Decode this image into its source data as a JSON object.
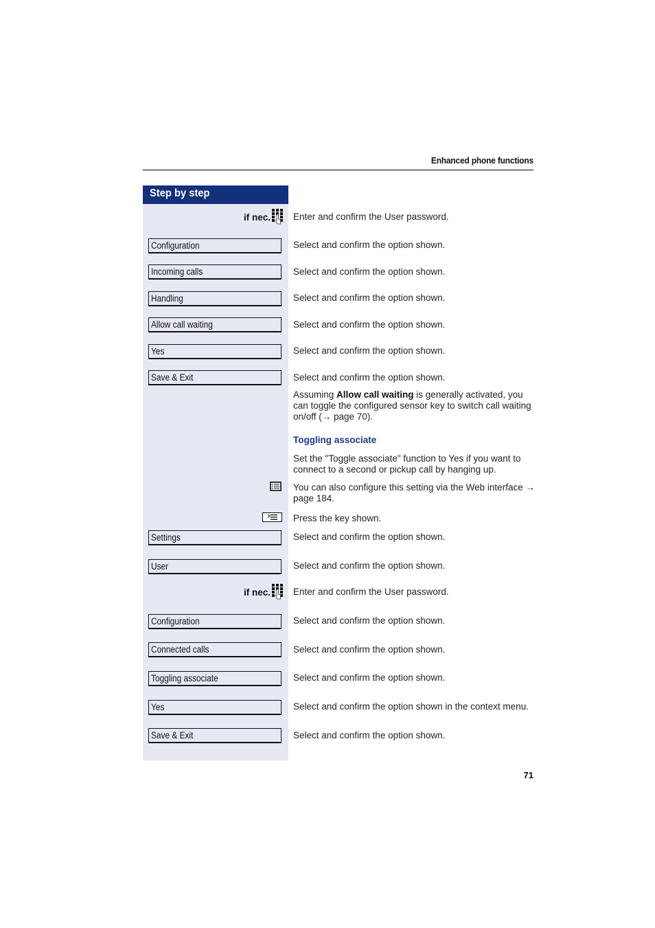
{
  "header": {
    "running_title": "Enhanced phone functions"
  },
  "step_header": "Step by step",
  "steps_part1": [
    {
      "type": "ifnec",
      "label": "if nec.",
      "icon": "keypad-icon",
      "text": "Enter and confirm the User password."
    },
    {
      "type": "menu",
      "label": "Configuration",
      "text": "Select and confirm the option shown."
    },
    {
      "type": "menu",
      "label": "Incoming calls",
      "text": "Select and confirm the option shown."
    },
    {
      "type": "menu",
      "label": "Handling",
      "text": "Select and confirm the option shown."
    },
    {
      "type": "menu",
      "label": "Allow call waiting",
      "text": "Select and confirm the option shown."
    },
    {
      "type": "menu",
      "label": "Yes",
      "text": "Select and confirm the option shown."
    },
    {
      "type": "menu",
      "label": "Save & Exit",
      "text": "Select and confirm the option shown."
    }
  ],
  "note": {
    "prefix": "Assuming ",
    "bold": "Allow call waiting",
    "suffix": " is generally activated, you can toggle the configured sensor key to switch call waiting on/off (→ page 70)."
  },
  "section": {
    "title": "Toggling associate",
    "intro": "Set the \"Toggle associate\" function to Yes if you want to connect to a second or pickup call by hanging up.",
    "web_note": "You can also configure this setting via the Web interface → page 184.",
    "web_icon": "web-interface-icon",
    "press_key": "Press the key shown.",
    "press_icon": "menu-key-icon"
  },
  "steps_part2": [
    {
      "type": "menu",
      "label": "Settings",
      "text": "Select and confirm the option shown."
    },
    {
      "type": "menu",
      "label": "User",
      "text": "Select and confirm the option shown."
    },
    {
      "type": "ifnec",
      "label": "if nec.",
      "icon": "keypad-icon",
      "text": "Enter and confirm the User password."
    },
    {
      "type": "menu",
      "label": "Configuration",
      "text": "Select and confirm the option shown."
    },
    {
      "type": "menu",
      "label": "Connected calls",
      "text": "Select and confirm the option shown."
    },
    {
      "type": "menu",
      "label": "Toggling associate",
      "text": "Select and confirm the option shown."
    },
    {
      "type": "menu",
      "label": "Yes",
      "text": "Select and confirm the option shown in the context menu."
    },
    {
      "type": "menu",
      "label": "Save & Exit",
      "text": "Select and confirm the option shown."
    }
  ],
  "page_number": "71",
  "colors": {
    "header_bg": "#13307a",
    "sidebar_bg": "#e6e9f3",
    "subhead": "#1a3a8a"
  }
}
